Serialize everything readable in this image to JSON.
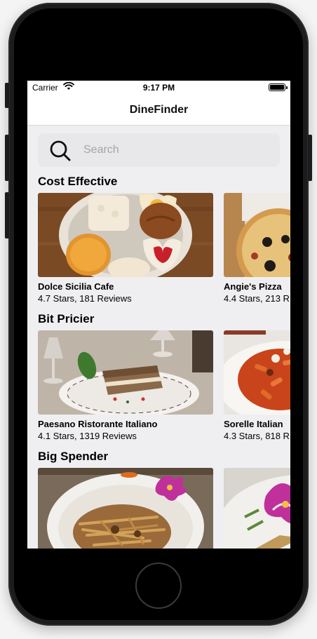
{
  "status_bar": {
    "carrier": "Carrier",
    "time": "9:17 PM"
  },
  "nav": {
    "title": "DineFinder"
  },
  "search": {
    "placeholder": "Search"
  },
  "sections": [
    {
      "title": "Cost Effective",
      "cards": [
        {
          "name": "Dolce Sicilia Cafe",
          "meta": "4.7 Stars, 181 Reviews"
        },
        {
          "name": "Angie's Pizza",
          "meta": "4.4 Stars, 213 R"
        }
      ]
    },
    {
      "title": "Bit Pricier",
      "cards": [
        {
          "name": "Paesano Ristorante Italiano",
          "meta": "4.1 Stars, 1319 Reviews"
        },
        {
          "name": "Sorelle Italian",
          "meta": "4.3 Stars, 818 R"
        }
      ]
    },
    {
      "title": "Big Spender",
      "cards": [
        {
          "name": "",
          "meta": ""
        },
        {
          "name": "",
          "meta": ""
        }
      ]
    }
  ]
}
